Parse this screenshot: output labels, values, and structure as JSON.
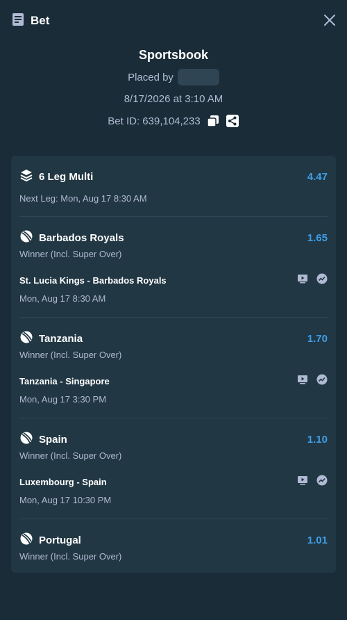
{
  "header": {
    "title": "Bet"
  },
  "summary": {
    "book": "Sportsbook",
    "placed_by": "Placed by",
    "datetime": "8/17/2026 at 3:10 AM",
    "bet_id": "Bet ID: 639,104,233"
  },
  "multi": {
    "label": "6 Leg Multi",
    "odds": "4.47",
    "next_leg": "Next Leg: Mon, Aug 17 8:30 AM"
  },
  "legs": [
    {
      "selection": "Barbados Royals",
      "odds": "1.65",
      "market": "Winner (Incl. Super Over)",
      "match": "St. Lucia Kings - Barbados Royals",
      "time": "Mon, Aug 17  8:30 AM"
    },
    {
      "selection": "Tanzania",
      "odds": "1.70",
      "market": "Winner (Incl. Super Over)",
      "match": "Tanzania - Singapore",
      "time": "Mon, Aug 17  3:30 PM"
    },
    {
      "selection": "Spain",
      "odds": "1.10",
      "market": "Winner (Incl. Super Over)",
      "match": "Luxembourg - Spain",
      "time": "Mon, Aug 17  10:30 PM"
    },
    {
      "selection": "Portugal",
      "odds": "1.01",
      "market": "Winner (Incl. Super Over)",
      "match": "",
      "time": ""
    }
  ],
  "colors": {
    "background": "#1a2c38",
    "card": "#213743",
    "accent_odds": "#3d9ee8",
    "divider": "#2f4553"
  },
  "icons": [
    "receipt-icon",
    "close-icon",
    "copy-icon",
    "share-icon",
    "layers-icon",
    "cricket-ball-icon",
    "live-stream-icon",
    "stats-icon"
  ]
}
